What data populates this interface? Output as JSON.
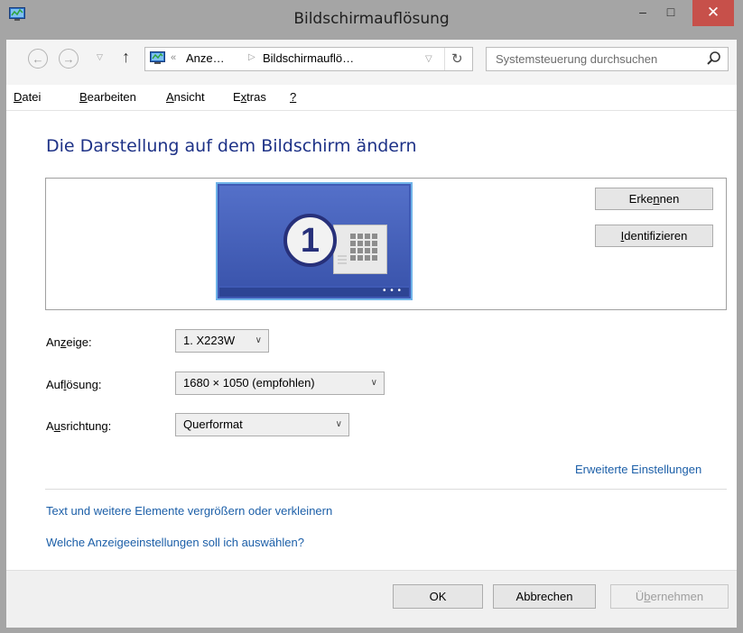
{
  "window": {
    "title": "Bildschirmauflösung"
  },
  "titlebar_buttons": {
    "minimize": "–",
    "maximize": "□",
    "close": "✕"
  },
  "nav": {
    "up_arrow": "↑"
  },
  "address": {
    "segment1": "Anze…",
    "segment2": "Bildschirmauflö…",
    "search_placeholder": "Systemsteuerung durchsuchen"
  },
  "menu": {
    "items": [
      {
        "pre": "",
        "u": "D",
        "post": "atei"
      },
      {
        "pre": "",
        "u": "B",
        "post": "earbeiten"
      },
      {
        "pre": "",
        "u": "A",
        "post": "nsicht"
      },
      {
        "pre": "E",
        "u": "x",
        "post": "tras"
      },
      {
        "pre": "",
        "u": "?",
        "post": ""
      }
    ]
  },
  "main": {
    "heading": "Die Darstellung auf dem Bildschirm ändern",
    "monitor_number": "1",
    "monitor_dots": "• • •",
    "buttons": {
      "detect": {
        "pre": "Erke",
        "u": "n",
        "post": "nen"
      },
      "identify": {
        "pre": "",
        "u": "I",
        "post": "dentifizieren"
      }
    },
    "fields": {
      "display": {
        "label_pre": "An",
        "label_u": "z",
        "label_post": "eige:",
        "value": "1. X223W"
      },
      "resolution": {
        "label_pre": "Auf",
        "label_u": "l",
        "label_post": "ösung:",
        "value": "1680 × 1050 (empfohlen)"
      },
      "orientation": {
        "label_pre": "A",
        "label_u": "u",
        "label_post": "srichtung:",
        "value": "Querformat"
      }
    },
    "advanced_link": "Erweiterte Einstellungen",
    "links": [
      "Text und weitere Elemente vergrößern oder verkleinern",
      "Welche Anzeigeeinstellungen soll ich auswählen?"
    ]
  },
  "footer": {
    "ok": "OK",
    "cancel": "Abbrechen",
    "apply": {
      "pre": "Ü",
      "u": "b",
      "post": "ernehmen"
    }
  },
  "colors": {
    "titlebar": "#a5a5a5",
    "close": "#c7504a",
    "heading": "#1e3287",
    "link": "#1c5fa8",
    "monitor": "#3f5ab5"
  }
}
